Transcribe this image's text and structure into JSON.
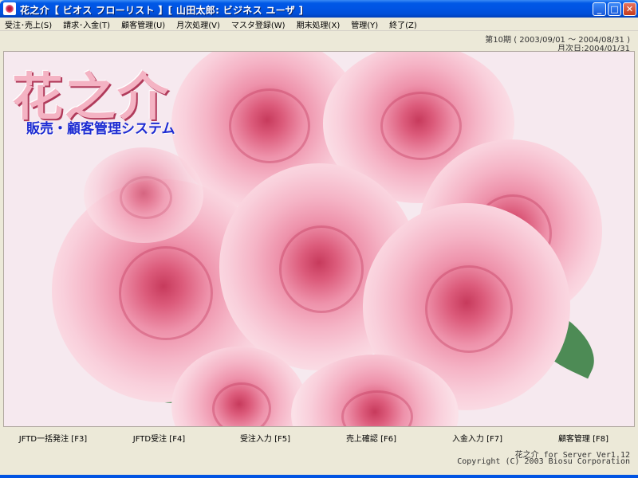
{
  "window": {
    "title": "花之介【 ビオス フローリスト 】[ 山田太郎: ビジネス ユーザ ]",
    "minimize_label": "_",
    "maximize_label": "□",
    "close_label": "✕"
  },
  "menu": {
    "items": [
      {
        "label": "受注･売上(S)"
      },
      {
        "label": "請求･入金(T)"
      },
      {
        "label": "顧客管理(U)"
      },
      {
        "label": "月次処理(V)"
      },
      {
        "label": "マスタ登録(W)"
      },
      {
        "label": "期末処理(X)"
      },
      {
        "label": "管理(Y)"
      },
      {
        "label": "終了(Z)"
      }
    ]
  },
  "info": {
    "period": "第10期 ( 2003/09/01 ～ 2004/08/31 )",
    "month_end": "月次日:2004/01/31"
  },
  "logo": {
    "title": "花之介",
    "subtitle": "販売・顧客管理システム"
  },
  "fkeys": [
    {
      "label": "JFTD一括発注 [F3]"
    },
    {
      "label": "JFTD受注 [F4]"
    },
    {
      "label": "受注入力 [F5]"
    },
    {
      "label": "売上確認 [F6]"
    },
    {
      "label": "入金入力 [F7]"
    },
    {
      "label": "顧客管理 [F8]"
    }
  ],
  "status": {
    "version": "花之介 for Server Ver1.12",
    "copyright": "Copyright (C) 2003 Biosu Corporation"
  },
  "colors": {
    "titlebar": "#0054e3",
    "logo_title": "#f4b3c3",
    "logo_subtitle": "#1d2bd2"
  }
}
